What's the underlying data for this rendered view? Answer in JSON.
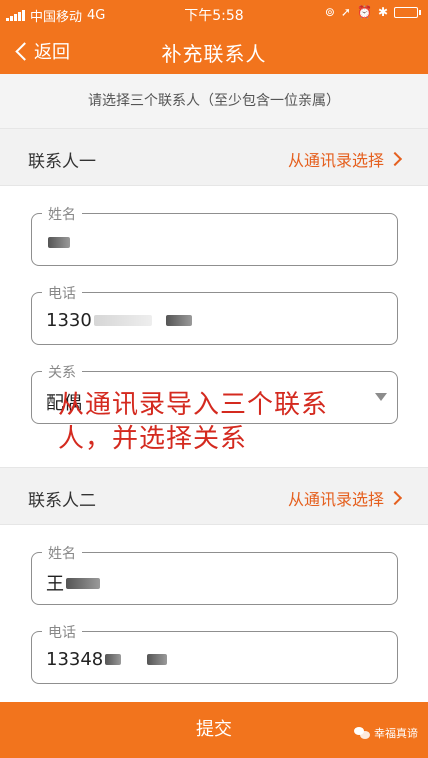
{
  "status_bar": {
    "carrier": "中国移动",
    "network": "4G",
    "time": "下午5:58",
    "icons": [
      "rotation-lock-icon",
      "location-icon",
      "alarm-icon",
      "bluetooth-icon",
      "battery-icon"
    ]
  },
  "nav": {
    "back_label": "返回",
    "title": "补充联系人"
  },
  "hint": "请选择三个联系人（至少包含一位亲属）",
  "contacts": [
    {
      "title": "联系人一",
      "pick_label": "从通讯录选择",
      "name_label": "姓名",
      "name_value": "",
      "phone_label": "电话",
      "phone_value": "1330",
      "relation_label": "关系",
      "relation_value": "配偶"
    },
    {
      "title": "联系人二",
      "pick_label": "从通讯录选择",
      "name_label": "姓名",
      "name_value": "王",
      "phone_label": "电话",
      "phone_value": "13348"
    }
  ],
  "annotation": "从通讯录导入三个联系人，并选择关系",
  "submit_label": "提交",
  "watermark": "幸福真谛",
  "colors": {
    "brand_orange": "#f2741d",
    "link_orange": "#e5601f",
    "annotation_red": "#d42a1f"
  }
}
